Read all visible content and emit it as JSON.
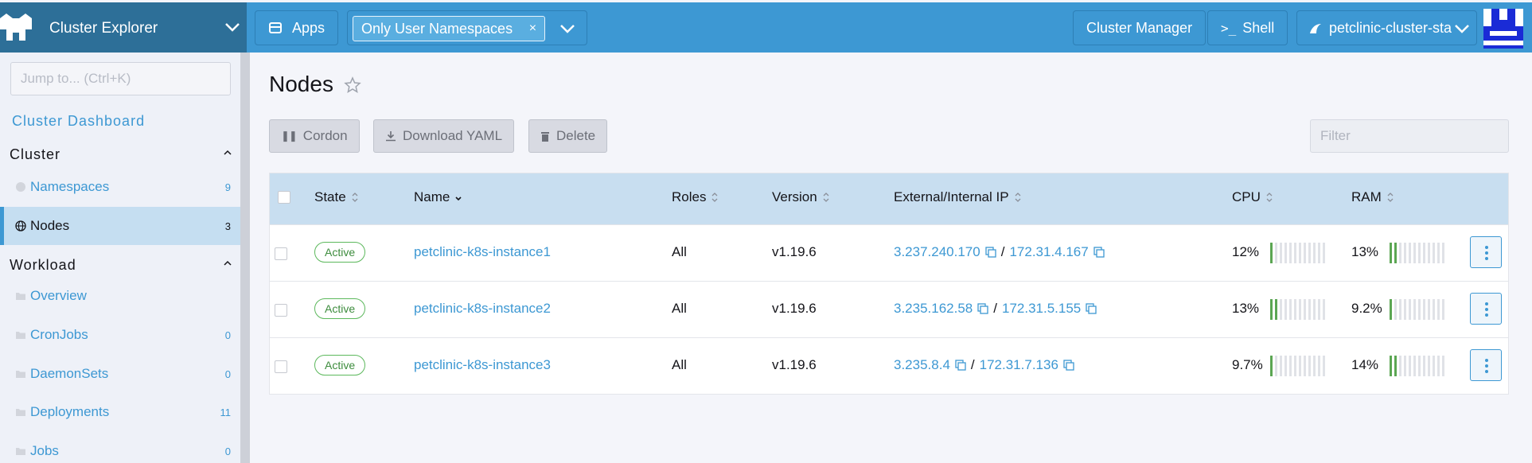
{
  "header": {
    "brand_title": "Cluster Explorer",
    "apps_label": "Apps",
    "namespace_filter": "Only User Namespaces",
    "namespace_remove": "×",
    "cluster_manager_label": "Cluster Manager",
    "shell_label": "Shell",
    "cluster_name": "petclinic-cluster-sta"
  },
  "sidebar": {
    "jump_placeholder": "Jump to... (Ctrl+K)",
    "dashboard_link": "Cluster Dashboard",
    "sections": [
      {
        "title": "Cluster"
      },
      {
        "title": "Workload"
      }
    ],
    "cluster_items": [
      {
        "label": "Namespaces",
        "count": "9",
        "icon": "namespace-icon"
      },
      {
        "label": "Nodes",
        "count": "3",
        "icon": "globe-icon",
        "active": true
      }
    ],
    "workload_items": [
      {
        "label": "Overview",
        "count": "",
        "icon": "folder-icon"
      },
      {
        "label": "CronJobs",
        "count": "0",
        "icon": "folder-icon"
      },
      {
        "label": "DaemonSets",
        "count": "0",
        "icon": "folder-icon"
      },
      {
        "label": "Deployments",
        "count": "11",
        "icon": "folder-icon"
      },
      {
        "label": "Jobs",
        "count": "0",
        "icon": "folder-icon"
      }
    ]
  },
  "main": {
    "title": "Nodes",
    "actions": {
      "cordon": "Cordon",
      "download_yaml": "Download YAML",
      "delete": "Delete"
    },
    "filter_placeholder": "Filter",
    "columns": {
      "state": "State",
      "name": "Name",
      "roles": "Roles",
      "version": "Version",
      "ip": "External/Internal IP",
      "cpu": "CPU",
      "ram": "RAM"
    },
    "rows": [
      {
        "state": "Active",
        "name": "petclinic-k8s-instance1",
        "roles": "All",
        "version": "v1.19.6",
        "external_ip": "3.237.240.170",
        "sep": "/",
        "internal_ip": "172.31.4.167",
        "cpu": "12%",
        "cpu_fraction": 0.12,
        "ram": "13%",
        "ram_fraction": 0.13
      },
      {
        "state": "Active",
        "name": "petclinic-k8s-instance2",
        "roles": "All",
        "version": "v1.19.6",
        "external_ip": "3.235.162.58",
        "sep": "/",
        "internal_ip": "172.31.5.155",
        "cpu": "13%",
        "cpu_fraction": 0.13,
        "ram": "9.2%",
        "ram_fraction": 0.092
      },
      {
        "state": "Active",
        "name": "petclinic-k8s-instance3",
        "roles": "All",
        "version": "v1.19.6",
        "external_ip": "3.235.8.4",
        "sep": "/",
        "internal_ip": "172.31.7.136",
        "cpu": "9.7%",
        "cpu_fraction": 0.097,
        "ram": "14%",
        "ram_fraction": 0.14
      }
    ]
  },
  "colors": {
    "accent": "#3d98d3",
    "brand_bg": "#2d6f98",
    "active_badge": "#5cb85c"
  }
}
